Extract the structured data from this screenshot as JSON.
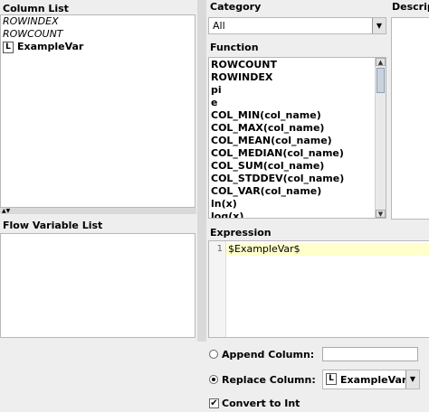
{
  "column_list": {
    "title": "Column List",
    "items": [
      {
        "label": "ROWINDEX",
        "italic": true
      },
      {
        "label": "ROWCOUNT",
        "italic": true
      },
      {
        "label": "ExampleVar",
        "icon": "L",
        "bold": true
      }
    ]
  },
  "flow_variable_list": {
    "title": "Flow Variable List"
  },
  "category": {
    "title": "Category",
    "selected": "All"
  },
  "description": {
    "title": "Description"
  },
  "function_list": {
    "title": "Function",
    "items": [
      "ROWCOUNT",
      "ROWINDEX",
      "pi",
      "e",
      "COL_MIN(col_name)",
      "COL_MAX(col_name)",
      "COL_MEAN(col_name)",
      "COL_MEDIAN(col_name)",
      "COL_SUM(col_name)",
      "COL_STDDEV(col_name)",
      "COL_VAR(col_name)",
      "ln(x)",
      "log(x)"
    ]
  },
  "expression": {
    "title": "Expression",
    "line_number": "1",
    "text": "$ExampleVar$",
    "highlight_color": "#ffffcc"
  },
  "output": {
    "append_label": "Append Column:",
    "append_value": "",
    "replace_label": "Replace Column:",
    "replace_icon": "L",
    "replace_value": "ExampleVar",
    "convert_label": "Convert to Int",
    "convert_checked": true,
    "mode": "replace"
  }
}
